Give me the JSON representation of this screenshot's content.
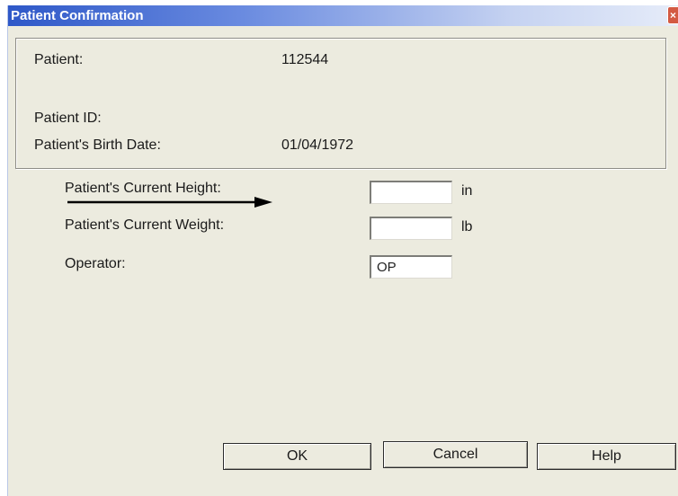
{
  "window": {
    "title": "Patient Confirmation",
    "close_glyph": "×"
  },
  "patient_info": {
    "patient_label": "Patient:",
    "patient_value": "112544",
    "patient_id_label": "Patient ID:",
    "patient_id_value": "",
    "birth_date_label": "Patient's Birth Date:",
    "birth_date_value": "01/04/1972"
  },
  "form": {
    "height_label": "Patient's Current Height:",
    "height_value": "",
    "height_unit": "in",
    "weight_label": "Patient's Current Weight:",
    "weight_value": "",
    "weight_unit": "lb",
    "operator_label": "Operator:",
    "operator_value": "OP"
  },
  "buttons": {
    "ok": "OK",
    "cancel": "Cancel",
    "help": "Help"
  },
  "annotation": {
    "arrow_icon": "right-arrow-icon"
  }
}
